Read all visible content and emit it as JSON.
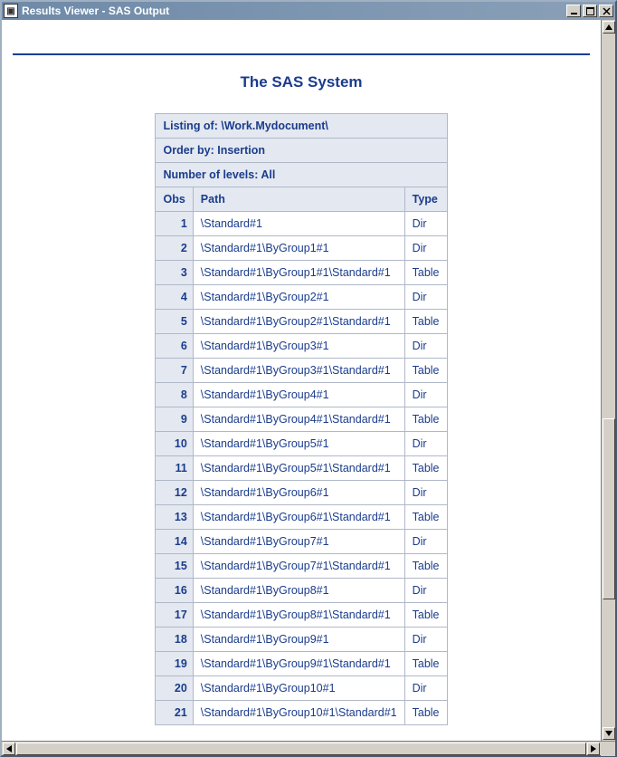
{
  "window": {
    "title": "Results Viewer - SAS Output"
  },
  "report": {
    "title": "The SAS System",
    "listing_of": "Listing of: \\Work.Mydocument\\",
    "order_by": "Order by: Insertion",
    "levels": "Number of levels: All",
    "columns": {
      "obs": "Obs",
      "path": "Path",
      "type": "Type"
    },
    "rows": [
      {
        "obs": "1",
        "path": "\\Standard#1",
        "type": "Dir"
      },
      {
        "obs": "2",
        "path": "\\Standard#1\\ByGroup1#1",
        "type": "Dir"
      },
      {
        "obs": "3",
        "path": "\\Standard#1\\ByGroup1#1\\Standard#1",
        "type": "Table"
      },
      {
        "obs": "4",
        "path": "\\Standard#1\\ByGroup2#1",
        "type": "Dir"
      },
      {
        "obs": "5",
        "path": "\\Standard#1\\ByGroup2#1\\Standard#1",
        "type": "Table"
      },
      {
        "obs": "6",
        "path": "\\Standard#1\\ByGroup3#1",
        "type": "Dir"
      },
      {
        "obs": "7",
        "path": "\\Standard#1\\ByGroup3#1\\Standard#1",
        "type": "Table"
      },
      {
        "obs": "8",
        "path": "\\Standard#1\\ByGroup4#1",
        "type": "Dir"
      },
      {
        "obs": "9",
        "path": "\\Standard#1\\ByGroup4#1\\Standard#1",
        "type": "Table"
      },
      {
        "obs": "10",
        "path": "\\Standard#1\\ByGroup5#1",
        "type": "Dir"
      },
      {
        "obs": "11",
        "path": "\\Standard#1\\ByGroup5#1\\Standard#1",
        "type": "Table"
      },
      {
        "obs": "12",
        "path": "\\Standard#1\\ByGroup6#1",
        "type": "Dir"
      },
      {
        "obs": "13",
        "path": "\\Standard#1\\ByGroup6#1\\Standard#1",
        "type": "Table"
      },
      {
        "obs": "14",
        "path": "\\Standard#1\\ByGroup7#1",
        "type": "Dir"
      },
      {
        "obs": "15",
        "path": "\\Standard#1\\ByGroup7#1\\Standard#1",
        "type": "Table"
      },
      {
        "obs": "16",
        "path": "\\Standard#1\\ByGroup8#1",
        "type": "Dir"
      },
      {
        "obs": "17",
        "path": "\\Standard#1\\ByGroup8#1\\Standard#1",
        "type": "Table"
      },
      {
        "obs": "18",
        "path": "\\Standard#1\\ByGroup9#1",
        "type": "Dir"
      },
      {
        "obs": "19",
        "path": "\\Standard#1\\ByGroup9#1\\Standard#1",
        "type": "Table"
      },
      {
        "obs": "20",
        "path": "\\Standard#1\\ByGroup10#1",
        "type": "Dir"
      },
      {
        "obs": "21",
        "path": "\\Standard#1\\ByGroup10#1\\Standard#1",
        "type": "Table"
      }
    ]
  }
}
